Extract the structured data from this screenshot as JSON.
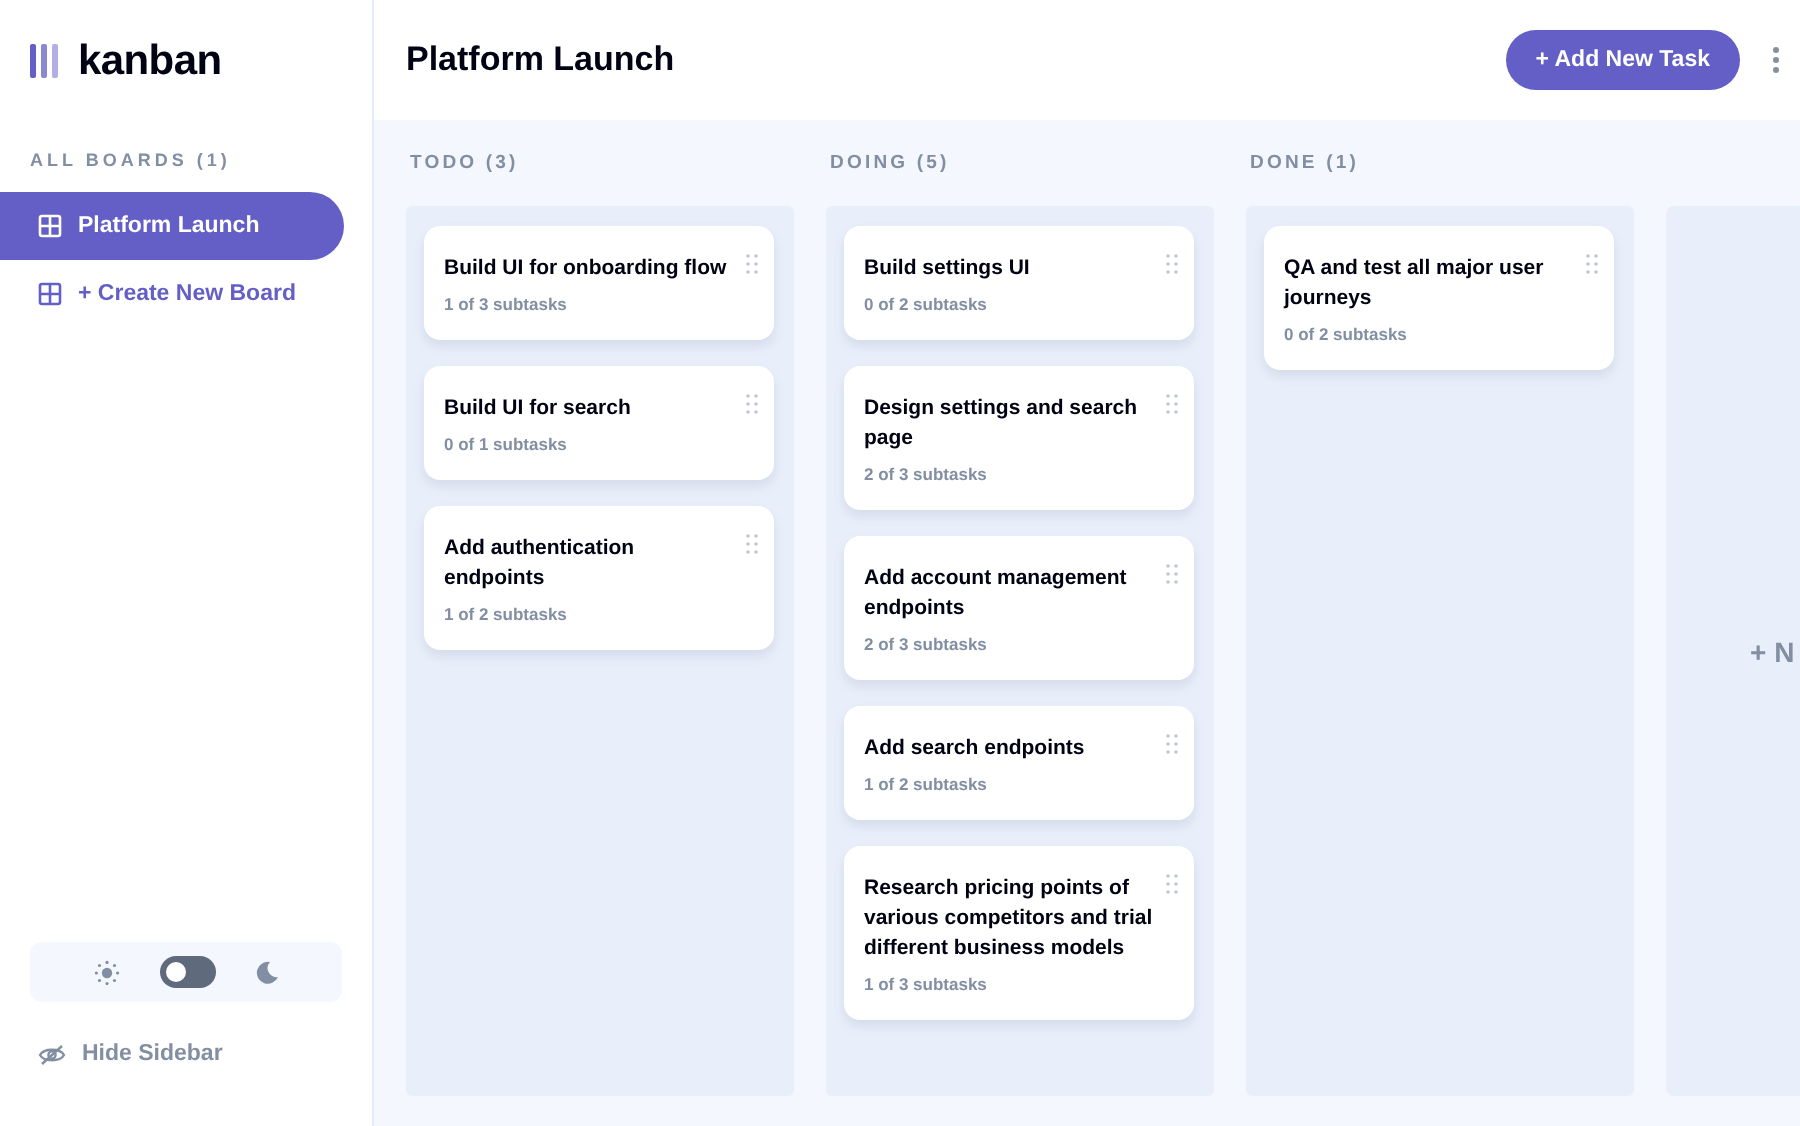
{
  "logo": {
    "text": "kanban"
  },
  "sidebar": {
    "heading": "ALL BOARDS (1)",
    "boards": [
      {
        "label": "Platform Launch",
        "selected": true
      }
    ],
    "create_label": "+ Create New Board",
    "theme_toggle": {
      "dark": false
    },
    "hide_label": "Hide Sidebar"
  },
  "header": {
    "title": "Platform Launch",
    "add_button": "+ Add New Task"
  },
  "columns": [
    {
      "title": "TODO (3)",
      "tasks": [
        {
          "title": "Build UI for onboarding flow",
          "subtasks": "1 of 3 subtasks"
        },
        {
          "title": "Build UI for search",
          "subtasks": "0 of 1 subtasks"
        },
        {
          "title": "Add authentication endpoints",
          "subtasks": "1 of 2 subtasks"
        }
      ]
    },
    {
      "title": "DOING (5)",
      "tasks": [
        {
          "title": "Build settings UI",
          "subtasks": "0 of 2 subtasks"
        },
        {
          "title": "Design settings and search page",
          "subtasks": "2 of 3 subtasks"
        },
        {
          "title": "Add account management endpoints",
          "subtasks": "2 of 3 subtasks"
        },
        {
          "title": "Add search endpoints",
          "subtasks": "1 of 2 subtasks"
        },
        {
          "title": "Research pricing points of various competitors and trial different business models",
          "subtasks": "1 of 3 subtasks"
        }
      ]
    },
    {
      "title": "DONE (1)",
      "tasks": [
        {
          "title": "QA and test all major user journeys",
          "subtasks": "0 of 2 subtasks"
        }
      ]
    }
  ],
  "new_column": {
    "label": "+ N"
  }
}
